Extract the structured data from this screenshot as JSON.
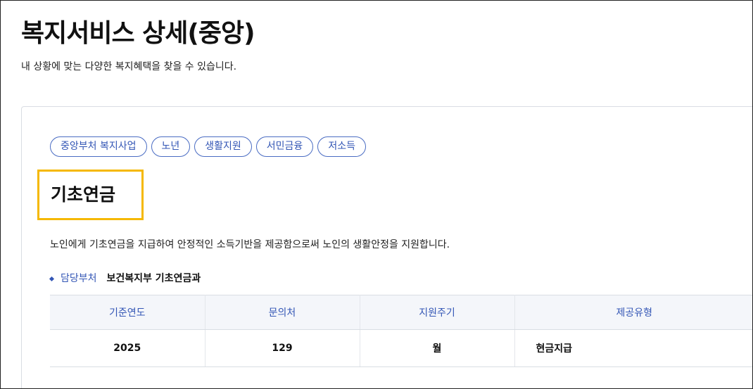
{
  "header": {
    "title": "복지서비스 상세(중앙)",
    "subtitle": "내 상황에 맞는 다양한 복지혜택을 찾을 수 있습니다."
  },
  "service": {
    "tags": [
      "중앙부처 복지사업",
      "노년",
      "생활지원",
      "서민금융",
      "저소득"
    ],
    "title": "기초연금",
    "description": "노인에게 기초연금을 지급하여 안정적인 소득기반을 제공함으로써 노인의 생활안정을 지원합니다.",
    "department": {
      "label": "담당부처",
      "value": "보건복지부 기초연금과"
    },
    "table": {
      "headers": [
        "기준연도",
        "문의처",
        "지원주기",
        "제공유형"
      ],
      "rows": [
        [
          "2025",
          "129",
          "월",
          "현금지급"
        ]
      ]
    }
  },
  "colors": {
    "accent": "#3356b5",
    "highlight_border": "#f5b800",
    "table_header_bg": "#f4f6fa"
  },
  "icons": {
    "dept_bullet": "diamond-bullet-icon"
  }
}
